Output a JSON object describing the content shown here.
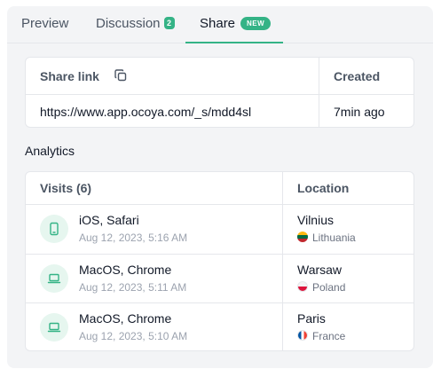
{
  "tabs": {
    "preview": "Preview",
    "discussion": "Discussion",
    "discussion_count": "2",
    "share": "Share",
    "share_badge": "NEW",
    "active": "Share"
  },
  "share_table": {
    "col_link": "Share link",
    "col_created": "Created",
    "link": "https://www.app.ocoya.com/_s/mdd4sl",
    "created": "7min ago",
    "copy_icon": "copy-icon"
  },
  "analytics": {
    "title": "Analytics",
    "col_visits": "Visits (6)",
    "col_location": "Location",
    "rows": [
      {
        "icon": "smartphone-icon",
        "device": "iOS, Safari",
        "datetime": "Aug 12, 2023, 5:16 AM",
        "city": "Vilnius",
        "country": "Lithuania",
        "flag": "lithuania-flag-icon"
      },
      {
        "icon": "laptop-icon",
        "device": "MacOS, Chrome",
        "datetime": "Aug 12, 2023, 5:11 AM",
        "city": "Warsaw",
        "country": "Poland",
        "flag": "poland-flag-icon"
      },
      {
        "icon": "laptop-icon",
        "device": "MacOS, Chrome",
        "datetime": "Aug 12, 2023, 5:10 AM",
        "city": "Paris",
        "country": "France",
        "flag": "france-flag-icon"
      }
    ]
  },
  "colors": {
    "accent": "#34b386",
    "icon_bg": "#e6f6ef",
    "panel_bg": "#f3f4f6",
    "border": "#e5e7eb"
  }
}
